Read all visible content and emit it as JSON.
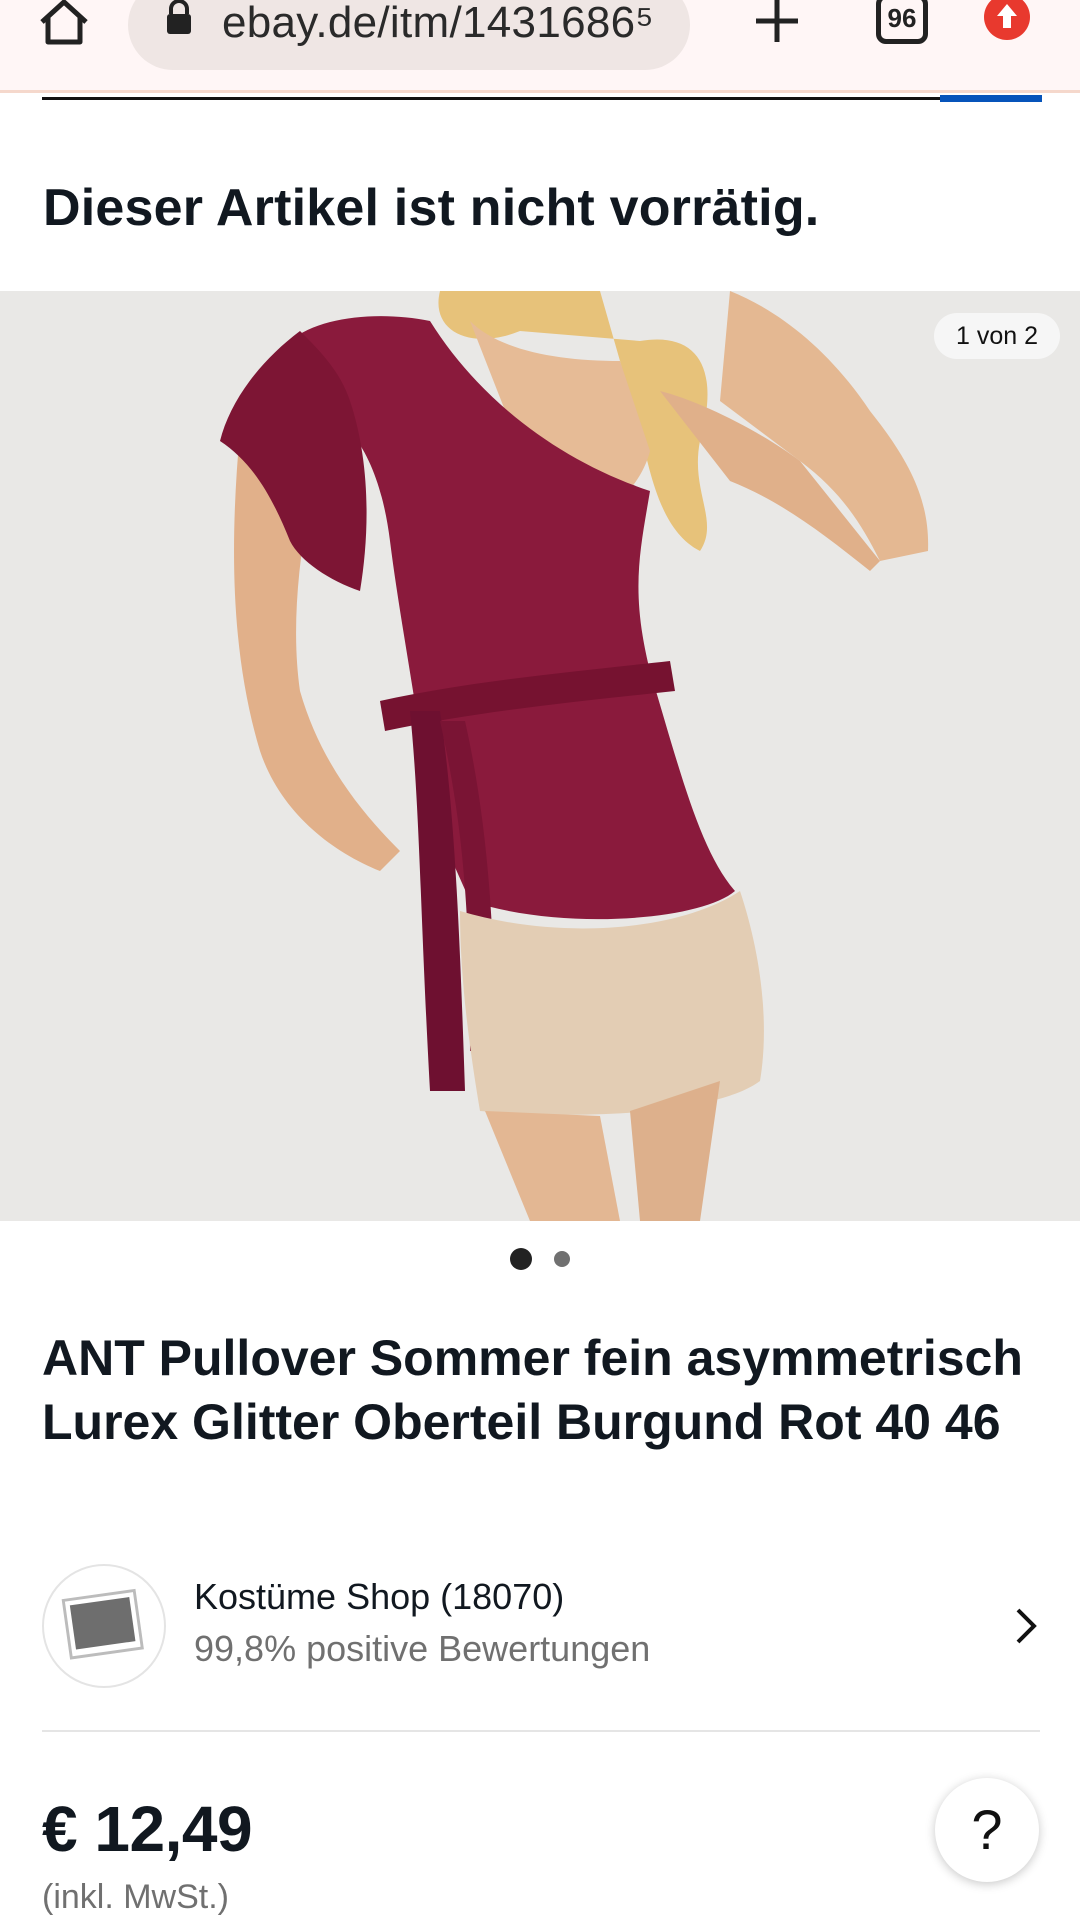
{
  "browser": {
    "url": "ebay.de/itm/1431686⁵",
    "tab_count": "96",
    "icons": [
      "home-icon",
      "lock-icon",
      "plus-icon",
      "tabs-icon",
      "update-icon"
    ]
  },
  "status": {
    "message": "Dieser Artikel ist nicht vorrätig."
  },
  "gallery": {
    "counter": "1 von 2",
    "total_images": 2,
    "active_index": 1
  },
  "product": {
    "title": "ANT Pullover Sommer fein asymmetrisch Lurex Glitter Oberteil Burgund Rot 40 46"
  },
  "seller": {
    "name": "Kostüme Shop (18070)",
    "rating": "99,8% positive Bewertungen"
  },
  "pricing": {
    "price": "€ 12,49",
    "tax_note": "(inkl. MwSt.)"
  },
  "help": {
    "label": "?"
  },
  "colors": {
    "ebay_blue": "#0654ba",
    "update_red": "#e8392e",
    "burgundy": "#8a1a3c"
  }
}
